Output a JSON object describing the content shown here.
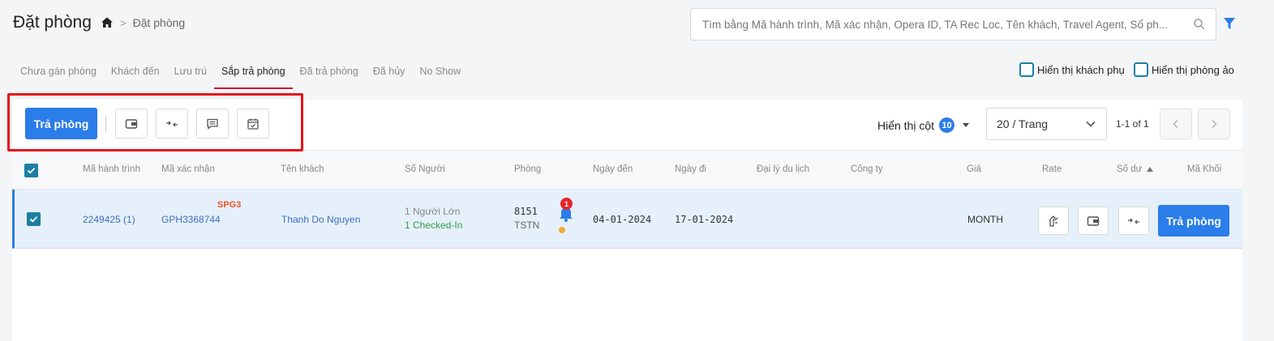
{
  "header": {
    "title": "Đặt phòng",
    "breadcrumb": {
      "separator": ">",
      "current": "Đặt phòng"
    }
  },
  "search": {
    "placeholder": "Tìm bằng Mã hành trình, Mã xác nhận, Opera ID, TA Rec Loc, Tên khách, Travel Agent, Số ph..."
  },
  "tabs": [
    {
      "label": "Chưa gán phòng"
    },
    {
      "label": "Khách đến"
    },
    {
      "label": "Lưu trú"
    },
    {
      "label": "Sắp trả phòng",
      "active": true
    },
    {
      "label": "Đã trả phòng"
    },
    {
      "label": "Đã hủy"
    },
    {
      "label": "No Show"
    }
  ],
  "options": {
    "show_sub_guest": "Hiển thị khách phụ",
    "show_virtual_room": "Hiển thị phòng ảo"
  },
  "toolbar": {
    "checkout_label": "Trả phòng",
    "column_display_label": "Hiển thị cột",
    "column_count": "10",
    "page_size": "20 / Trang",
    "page_info": "1-1 of 1"
  },
  "table": {
    "headers": {
      "itinerary": "Mã hành trình",
      "confirmation": "Mã xác nhận",
      "guest_name": "Tên khách",
      "guests": "Số Người",
      "room": "Phòng",
      "arrival": "Ngày đến",
      "departure": "Ngày đi",
      "travel_agent": "Đại lý du lịch",
      "company": "Công ty",
      "price": "Giá",
      "rate": "Rate",
      "balance": "Số dư",
      "block_code": "Mã Khối"
    },
    "rows": [
      {
        "itinerary": "2249425 (1)",
        "confirmation": "GPH3368744",
        "tag": "SPG3",
        "guest_name": "Thanh Do Nguyen",
        "adults": "1 Người Lớn",
        "checked_in": "1 Checked-In",
        "room_number": "8151",
        "room_type": "TSTN",
        "notification_count": "1",
        "arrival": "04-01-2024",
        "departure": "17-01-2024",
        "price": "MONTH",
        "checkout_label": "Trả phòng"
      }
    ]
  },
  "colors": {
    "primary": "#2b7de9",
    "checkbox": "#1b7fa3",
    "active_tab": "#c8102e",
    "highlight": "#e8101a",
    "tag": "#e8562a",
    "checked_in": "#2e9e4a"
  }
}
